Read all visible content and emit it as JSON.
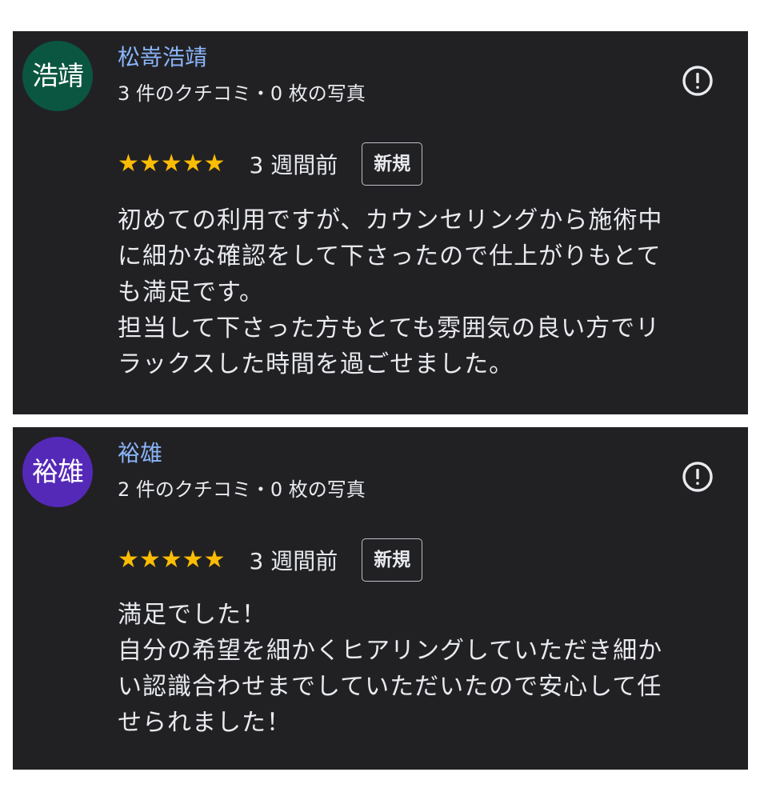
{
  "reviews": [
    {
      "avatar_text": "浩靖",
      "avatar_color": "#0b5640",
      "name": "松嵜浩靖",
      "stats": "3 件のクチコミ・0 枚の写真",
      "stars": "★★★★★",
      "rating": 5,
      "date": "3 週間前",
      "badge": "新規",
      "text_lines": [
        "初めての利用ですが、カウンセリングから施術中",
        "に細かな確認をして下さったので仕上がりもとて",
        "も満足です。",
        "担当して下さった方もとても雰囲気の良い方でリ",
        "ラックスした時間を過ごせました。"
      ]
    },
    {
      "avatar_text": "裕雄",
      "avatar_color": "#5529b8",
      "name": "裕雄",
      "stats": "2 件のクチコミ・0 枚の写真",
      "stars": "★★★★★",
      "rating": 5,
      "date": "3 週間前",
      "badge": "新規",
      "text_lines": [
        "満足でした！",
        "自分の希望を細かくヒアリングしていただき細か",
        "い認識合わせまでしていただいたので安心して任",
        "せられました！"
      ]
    }
  ],
  "icons": {
    "report": "report-flag-icon"
  },
  "colors": {
    "card_bg": "#212124",
    "name": "#8ab4f8",
    "star": "#fbbc04",
    "text": "#e8eaed"
  }
}
